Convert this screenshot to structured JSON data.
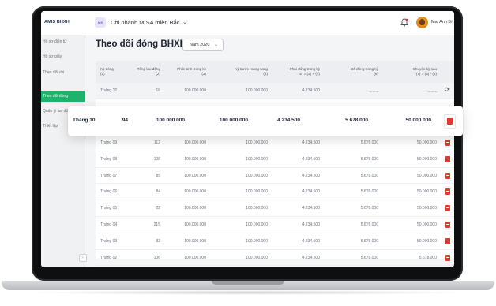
{
  "topbar": {
    "brand": "AMIS BHXH",
    "branch_badge": "MS",
    "branch_name": "Chi nhánh MISA miền Bắc",
    "username": "Mai Anh Bí"
  },
  "sidebar": {
    "items": [
      {
        "label": "Hồ sơ điện tử"
      },
      {
        "label": "Hồ sơ giấy"
      },
      {
        "label": "Theo dõi chi"
      },
      {
        "label": "Theo dõi đóng",
        "active": true
      },
      {
        "label": "Quản lý lao động"
      },
      {
        "label": "Thiết lập"
      }
    ]
  },
  "page": {
    "title": "Theo dõi đóng BHXH",
    "year_selected": "Năm 2020"
  },
  "table": {
    "headers": [
      {
        "line1": "Kỳ đóng",
        "line2": "(1)"
      },
      {
        "line1": "Tổng lao động",
        "line2": "(2)"
      },
      {
        "line1": "Phát sinh trong kỳ",
        "line2": "(3)"
      },
      {
        "line1": "Kỳ trước mang sang",
        "line2": "(4)"
      },
      {
        "line1": "Phải đóng trong kỳ",
        "line2": "(5) = (3) + (4)"
      },
      {
        "line1": "Đã đóng trong kỳ",
        "line2": "(6)"
      },
      {
        "line1": "Chuyển kỳ sau",
        "line2": "(7) = (5) - (6)"
      }
    ],
    "rows": [
      {
        "period": "Tháng 12",
        "labor": "18",
        "arising": "100.000.000",
        "prev": "100.000.000",
        "due": "4.234.500",
        "paid": "_ _ _",
        "carry": "_ _ _",
        "highlight": true,
        "icon": "sync-icon"
      },
      {
        "period": "Tháng 09",
        "labor": "112",
        "arising": "100.000.000",
        "prev": "100.000.000",
        "due": "4.234.500",
        "paid": "5.678.000",
        "carry": "50.000.000",
        "icon": "pdf-icon"
      },
      {
        "period": "Tháng 08",
        "labor": "108",
        "arising": "100.000.000",
        "prev": "100.000.000",
        "due": "4.234.500",
        "paid": "5.678.000",
        "carry": "50.000.000",
        "icon": "pdf-icon"
      },
      {
        "period": "Tháng 07",
        "labor": "85",
        "arising": "100.000.000",
        "prev": "100.000.000",
        "due": "4.234.500",
        "paid": "5.678.000",
        "carry": "50.000.000",
        "icon": "pdf-icon"
      },
      {
        "period": "Tháng 06",
        "labor": "84",
        "arising": "100.000.000",
        "prev": "100.000.000",
        "due": "4.234.500",
        "paid": "5.678.000",
        "carry": "50.000.000",
        "icon": "pdf-icon"
      },
      {
        "period": "Tháng 05",
        "labor": "22",
        "arising": "100.000.000",
        "prev": "100.000.000",
        "due": "4.234.500",
        "paid": "5.678.000",
        "carry": "50.000.000",
        "icon": "pdf-icon"
      },
      {
        "period": "Tháng 04",
        "labor": "215",
        "arising": "100.000.000",
        "prev": "100.000.000",
        "due": "4.234.500",
        "paid": "5.678.000",
        "carry": "50.000.000",
        "icon": "pdf-icon"
      },
      {
        "period": "Tháng 03",
        "labor": "82",
        "arising": "100.000.000",
        "prev": "100.000.000",
        "due": "4.234.500",
        "paid": "5.678.000",
        "carry": "50.000.000",
        "icon": "pdf-icon"
      },
      {
        "period": "Tháng 02",
        "labor": "106",
        "arising": "100.000.000",
        "prev": "100.000.000",
        "due": "4.234.500",
        "paid": "5.678.000",
        "carry": "5.678.000",
        "icon": "pdf-icon"
      }
    ],
    "focused_row": {
      "period": "Tháng 10",
      "labor": "94",
      "arising": "100.000.000",
      "prev": "100.000.000",
      "due": "4.234.500",
      "paid": "5.678.000",
      "carry": "50.000.000",
      "icon": "pdf-icon"
    }
  },
  "colors": {
    "accent": "#1eb36a",
    "pdf_icon": "#e0392e",
    "badge_bg": "#e8e4fb",
    "badge_text": "#6a4bd8"
  }
}
